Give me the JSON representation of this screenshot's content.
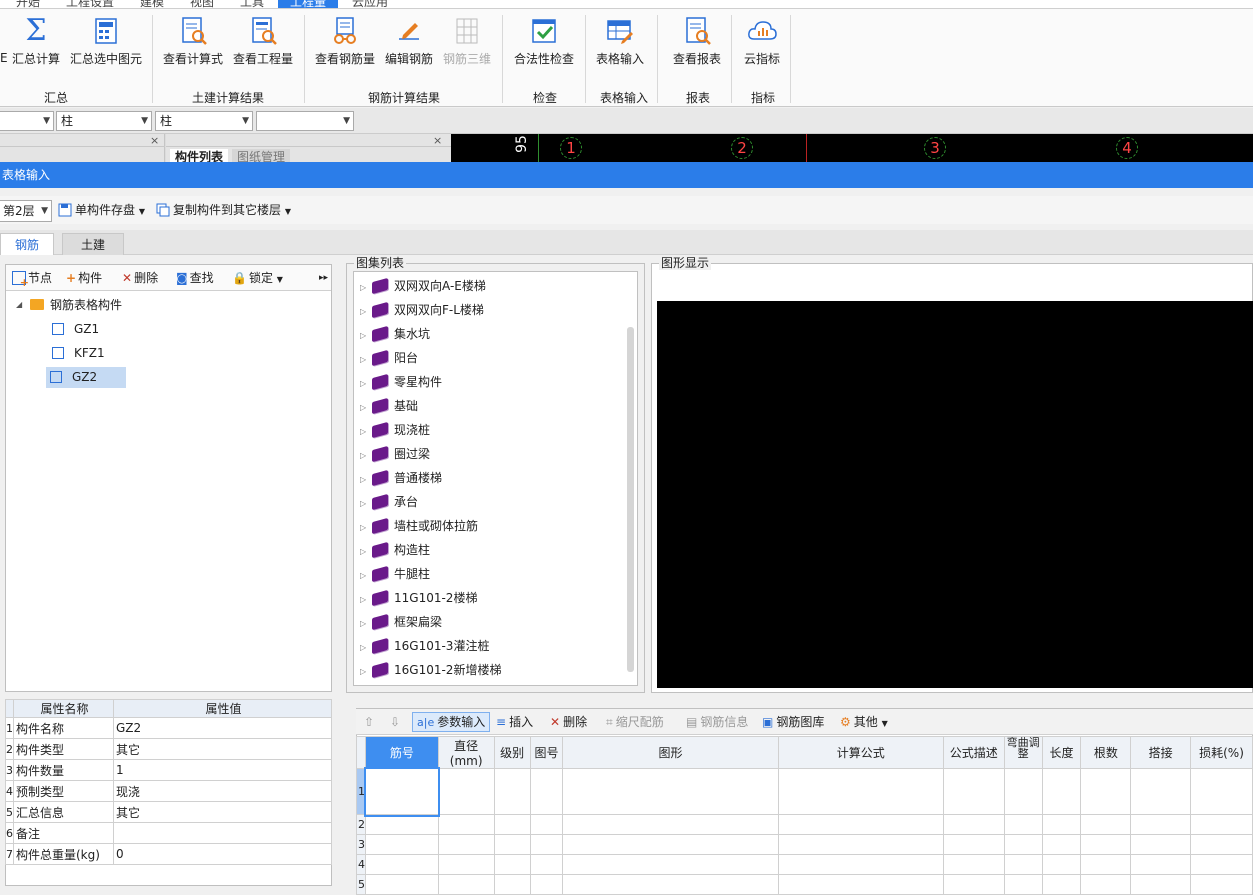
{
  "menu": {
    "tabs": [
      "开始",
      "工程设置",
      "建模",
      "视图",
      "工具",
      "工程量",
      "云应用"
    ],
    "active": "工程量"
  },
  "ribbon": {
    "buttons": [
      {
        "label": "汇总计算",
        "icon": "sigma-icon",
        "enabled": true
      },
      {
        "label": "汇总选中图元",
        "icon": "calculator-icon",
        "enabled": true
      },
      {
        "label": "查看计算式",
        "icon": "formula-search-icon",
        "enabled": true
      },
      {
        "label": "查看工程量",
        "icon": "quantity-search-icon",
        "enabled": true
      },
      {
        "label": "查看钢筋量",
        "icon": "rebar-glasses-icon",
        "enabled": true
      },
      {
        "label": "编辑钢筋",
        "icon": "pencil-icon",
        "enabled": true
      },
      {
        "label": "钢筋三维",
        "icon": "rebar-3d-icon",
        "enabled": false
      },
      {
        "label": "合法性检查",
        "icon": "checkmark-icon",
        "enabled": true
      },
      {
        "label": "表格输入",
        "icon": "table-pencil-icon",
        "enabled": true
      },
      {
        "label": "查看报表",
        "icon": "report-search-icon",
        "enabled": true
      },
      {
        "label": "云指标",
        "icon": "cloud-chart-icon",
        "enabled": true
      }
    ],
    "groups": [
      "汇总",
      "土建计算结果",
      "钢筋计算结果",
      "检查",
      "表格输入",
      "报表",
      "指标"
    ]
  },
  "combos": {
    "c1": "",
    "c2": "柱",
    "c3": "柱",
    "c4": ""
  },
  "upper_tabs": {
    "component_list": "构件列表",
    "drawing_mgmt": "图纸管理"
  },
  "canvas_axes": {
    "dim": "95",
    "labels": [
      "1",
      "2",
      "3",
      "4"
    ]
  },
  "panel_title": "表格输入",
  "toolbar2": {
    "floor": "第2层",
    "save": "单构件存盘",
    "copy": "复制构件到其它楼层"
  },
  "tabs": {
    "rebar": "钢筋",
    "civil": "土建"
  },
  "left_toolbar": {
    "node": "节点",
    "component": "构件",
    "delete": "删除",
    "find": "查找",
    "lock": "锁定"
  },
  "tree": {
    "root": "钢筋表格构件",
    "items": [
      "GZ1",
      "KFZ1",
      "GZ2"
    ],
    "selected": "GZ2"
  },
  "props": {
    "headers": [
      "属性名称",
      "属性值"
    ],
    "rows": [
      {
        "no": "1",
        "name": "构件名称",
        "value": "GZ2"
      },
      {
        "no": "2",
        "name": "构件类型",
        "value": "其它"
      },
      {
        "no": "3",
        "name": "构件数量",
        "value": "1"
      },
      {
        "no": "4",
        "name": "预制类型",
        "value": "现浇"
      },
      {
        "no": "5",
        "name": "汇总信息",
        "value": "其它"
      },
      {
        "no": "6",
        "name": "备注",
        "value": ""
      },
      {
        "no": "7",
        "name": "构件总重量(kg)",
        "value": "0"
      }
    ]
  },
  "atlas": {
    "title": "图集列表",
    "items": [
      "双网双向A-E楼梯",
      "双网双向F-L楼梯",
      "集水坑",
      "阳台",
      "零星构件",
      "基础",
      "现浇桩",
      "圈过梁",
      "普通楼梯",
      "承台",
      "墙柱或砌体拉筋",
      "构造柱",
      "牛腿柱",
      "11G101-2楼梯",
      "框架扁梁",
      "16G101-3灌注桩",
      "16G101-2新增楼梯"
    ]
  },
  "display": {
    "title": "图形显示"
  },
  "grid_toolbar": {
    "param": "参数输入",
    "insert": "插入",
    "delete": "删除",
    "scale": "缩尺配筋",
    "info": "钢筋信息",
    "library": "钢筋图库",
    "other": "其他"
  },
  "grid": {
    "headers": [
      "筋号",
      "直径(mm)",
      "级别",
      "图号",
      "图形",
      "计算公式",
      "公式描述",
      "弯曲调整",
      "长度",
      "根数",
      "搭接",
      "损耗(%)"
    ],
    "rows": [
      "1",
      "2",
      "3",
      "4",
      "5"
    ]
  }
}
